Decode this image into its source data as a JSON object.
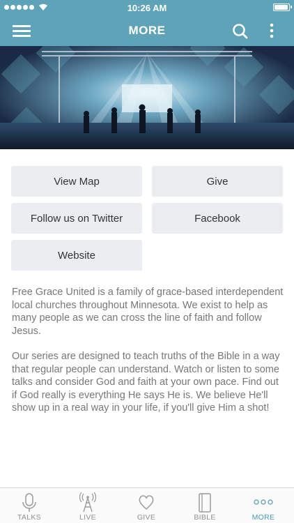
{
  "status_bar": {
    "time": "10:26 AM"
  },
  "nav": {
    "title": "MORE"
  },
  "buttons": {
    "view_map": "View Map",
    "give": "Give",
    "twitter": "Follow us on Twitter",
    "facebook": "Facebook",
    "website": "Website"
  },
  "description": {
    "para1": "Free Grace United is a family of grace-based interdependent local churches throughout Minnesota. We exist to help as many people as we can cross the line of faith and follow Jesus.",
    "para2": "Our series are designed to teach truths of the Bible in a way that regular people can understand. Watch or listen to some talks and consider God and faith at your own pace. Find out if God really is everything He says He is. We believe He'll show up in a real way in your life, if you'll give Him a shot!"
  },
  "tabs": [
    {
      "label": "TALKS",
      "icon": "microphone-icon"
    },
    {
      "label": "LIVE",
      "icon": "broadcast-tower-icon"
    },
    {
      "label": "GIVE",
      "icon": "heart-icon"
    },
    {
      "label": "BIBLE",
      "icon": "book-icon"
    },
    {
      "label": "MORE",
      "icon": "more-dots-icon",
      "active": true
    }
  ],
  "colors": {
    "accent": "#5fa3b8",
    "tab_active": "#4a98b6",
    "button_bg": "#ebedf0"
  }
}
